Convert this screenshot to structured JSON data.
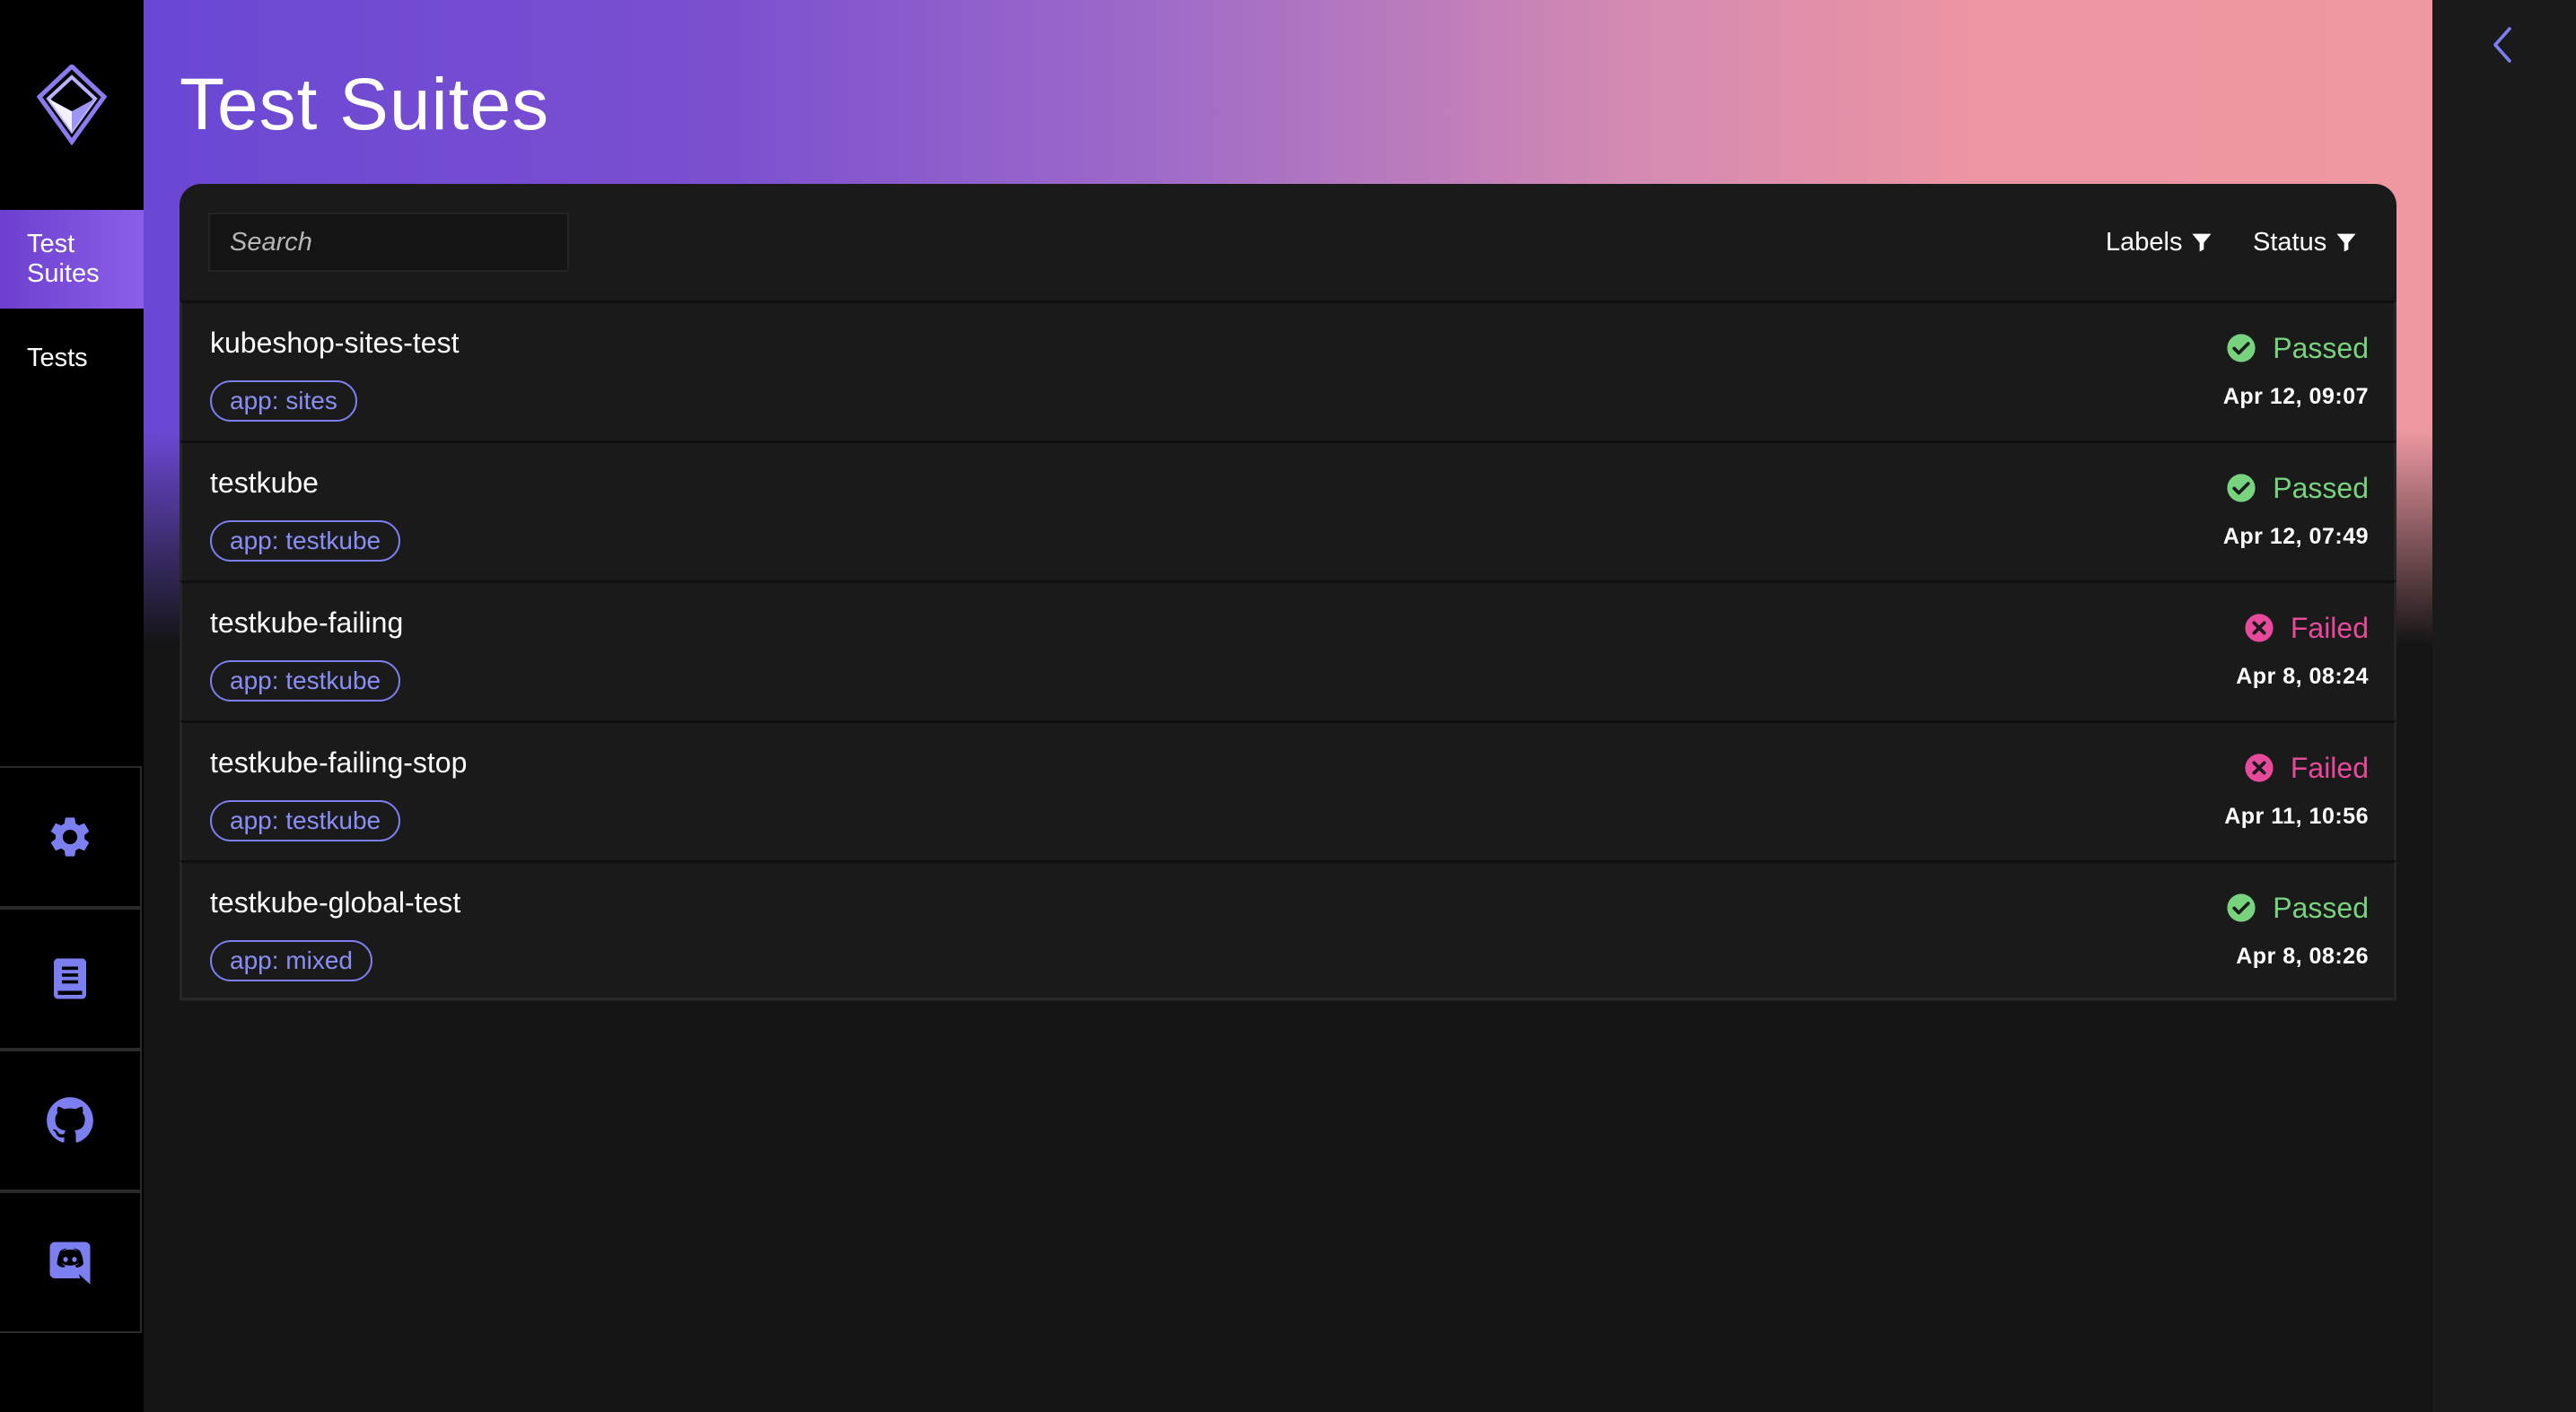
{
  "sidebar": {
    "nav": [
      {
        "label_line1": "Test",
        "label_line2": "Suites",
        "active": true
      },
      {
        "label": "Tests",
        "active": false
      }
    ],
    "buttons": [
      "settings-icon",
      "docs-book-icon",
      "github-icon",
      "discord-icon"
    ]
  },
  "page": {
    "title": "Test Suites"
  },
  "toolbar": {
    "search_placeholder": "Search",
    "labels_filter": "Labels",
    "status_filter": "Status"
  },
  "colors": {
    "accent": "#7b7ff0",
    "passed": "#78d37f",
    "failed": "#e7499b",
    "background": "#141414",
    "panel": "#1a1a1a"
  },
  "suites": [
    {
      "name": "kubeshop-sites-test",
      "tag": "app: sites",
      "status": "Passed",
      "date": "Apr 12, 09:07"
    },
    {
      "name": "testkube",
      "tag": "app: testkube",
      "status": "Passed",
      "date": "Apr 12, 07:49"
    },
    {
      "name": "testkube-failing",
      "tag": "app: testkube",
      "status": "Failed",
      "date": "Apr 8, 08:24"
    },
    {
      "name": "testkube-failing-stop",
      "tag": "app: testkube",
      "status": "Failed",
      "date": "Apr 11, 10:56"
    },
    {
      "name": "testkube-global-test",
      "tag": "app: mixed",
      "status": "Passed",
      "date": "Apr 8, 08:26"
    }
  ]
}
